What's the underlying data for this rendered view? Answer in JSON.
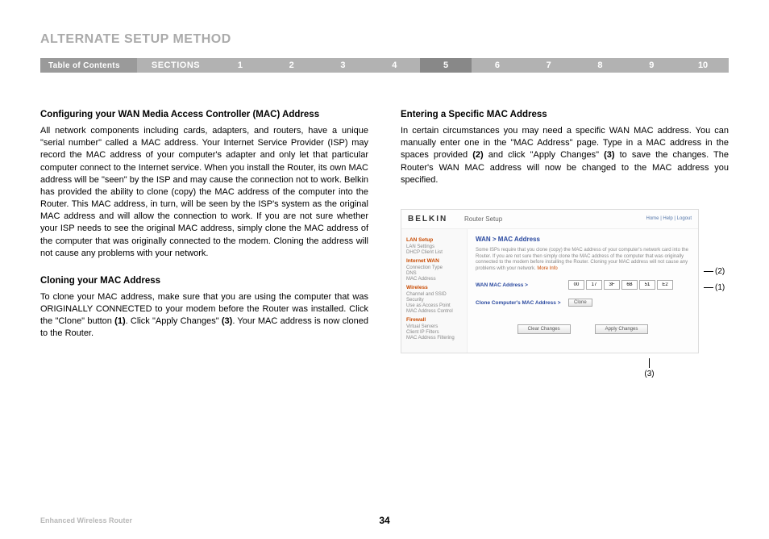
{
  "title": "ALTERNATE SETUP METHOD",
  "nav": {
    "toc": "Table of Contents",
    "sections_label": "SECTIONS",
    "items": [
      "1",
      "2",
      "3",
      "4",
      "5",
      "6",
      "7",
      "8",
      "9",
      "10"
    ],
    "active": "5"
  },
  "left": {
    "h1": "Configuring your WAN Media Access Controller (MAC) Address",
    "p1": "All network components including cards, adapters, and routers, have a unique \"serial number\" called a MAC address. Your Internet Service Provider (ISP) may record the MAC address of your computer's adapter and only let that particular computer connect to the Internet service. When you install the Router, its own MAC address will be \"seen\" by the ISP and may cause the connection not to work. Belkin has provided the ability to clone (copy) the MAC address of the computer into the Router. This MAC address, in turn, will be seen by the ISP's system as the original MAC address and will allow the connection to work. If you are not sure whether your ISP needs to see the original MAC address, simply clone the MAC address of the computer that was originally connected to the modem. Cloning the address will not cause any problems with your network.",
    "h2": "Cloning your MAC Address",
    "p2_a": "To clone your MAC address, make sure that you are using the computer that was ORIGINALLY CONNECTED to your modem before the Router was installed. Click the \"Clone\" button ",
    "p2_b1": "(1)",
    "p2_c": ". Click \"Apply Changes\" ",
    "p2_b2": "(3)",
    "p2_d": ". Your MAC address is now cloned to the Router."
  },
  "right": {
    "h1": "Entering a Specific MAC Address",
    "p1_a": "In certain circumstances you may need a specific WAN MAC address. You can manually enter one in the \"MAC Address\" page. Type in a MAC address in the spaces provided ",
    "p1_b1": "(2)",
    "p1_b": " and click \"Apply Changes\" ",
    "p1_b2": "(3)",
    "p1_c": " to save the changes. The Router's WAN MAC address will now be changed to the MAC address you specified."
  },
  "router": {
    "brand": "BELKIN",
    "title": "Router Setup",
    "links": "Home | Help | Logout",
    "breadcrumb": "WAN > MAC Address",
    "note": "Some ISPs require that you clone (copy) the MAC address of your computer's network card into the Router. If you are not sure then simply clone the MAC address of the computer that was originally connected to the modem before installing the Router. Cloning your MAC address will not cause any problems with your network.",
    "more": "More Info",
    "row1_label": "WAN MAC Address >",
    "mac": [
      "00",
      "17",
      "3F",
      "6B",
      "51",
      "E2"
    ],
    "row2_label": "Clone Computer's MAC Address >",
    "clone_btn": "Clone",
    "clear_btn": "Clear Changes",
    "apply_btn": "Apply Changes",
    "sidebar": {
      "g1": "LAN Setup",
      "g1_items": [
        "LAN Settings",
        "DHCP Client List"
      ],
      "g2": "Internet WAN",
      "g2_items": [
        "Connection Type",
        "DNS",
        "MAC Address"
      ],
      "g3": "Wireless",
      "g3_items": [
        "Channel and SSID",
        "Security",
        "Use as Access Point",
        "MAC Address Control"
      ],
      "g4": "Firewall",
      "g4_items": [
        "Virtual Servers",
        "Client IP Filters",
        "MAC Address Filtering"
      ]
    }
  },
  "annotations": {
    "a1": "(1)",
    "a2": "(2)",
    "a3": "(3)"
  },
  "footer": {
    "product": "Enhanced Wireless Router",
    "page": "34"
  }
}
